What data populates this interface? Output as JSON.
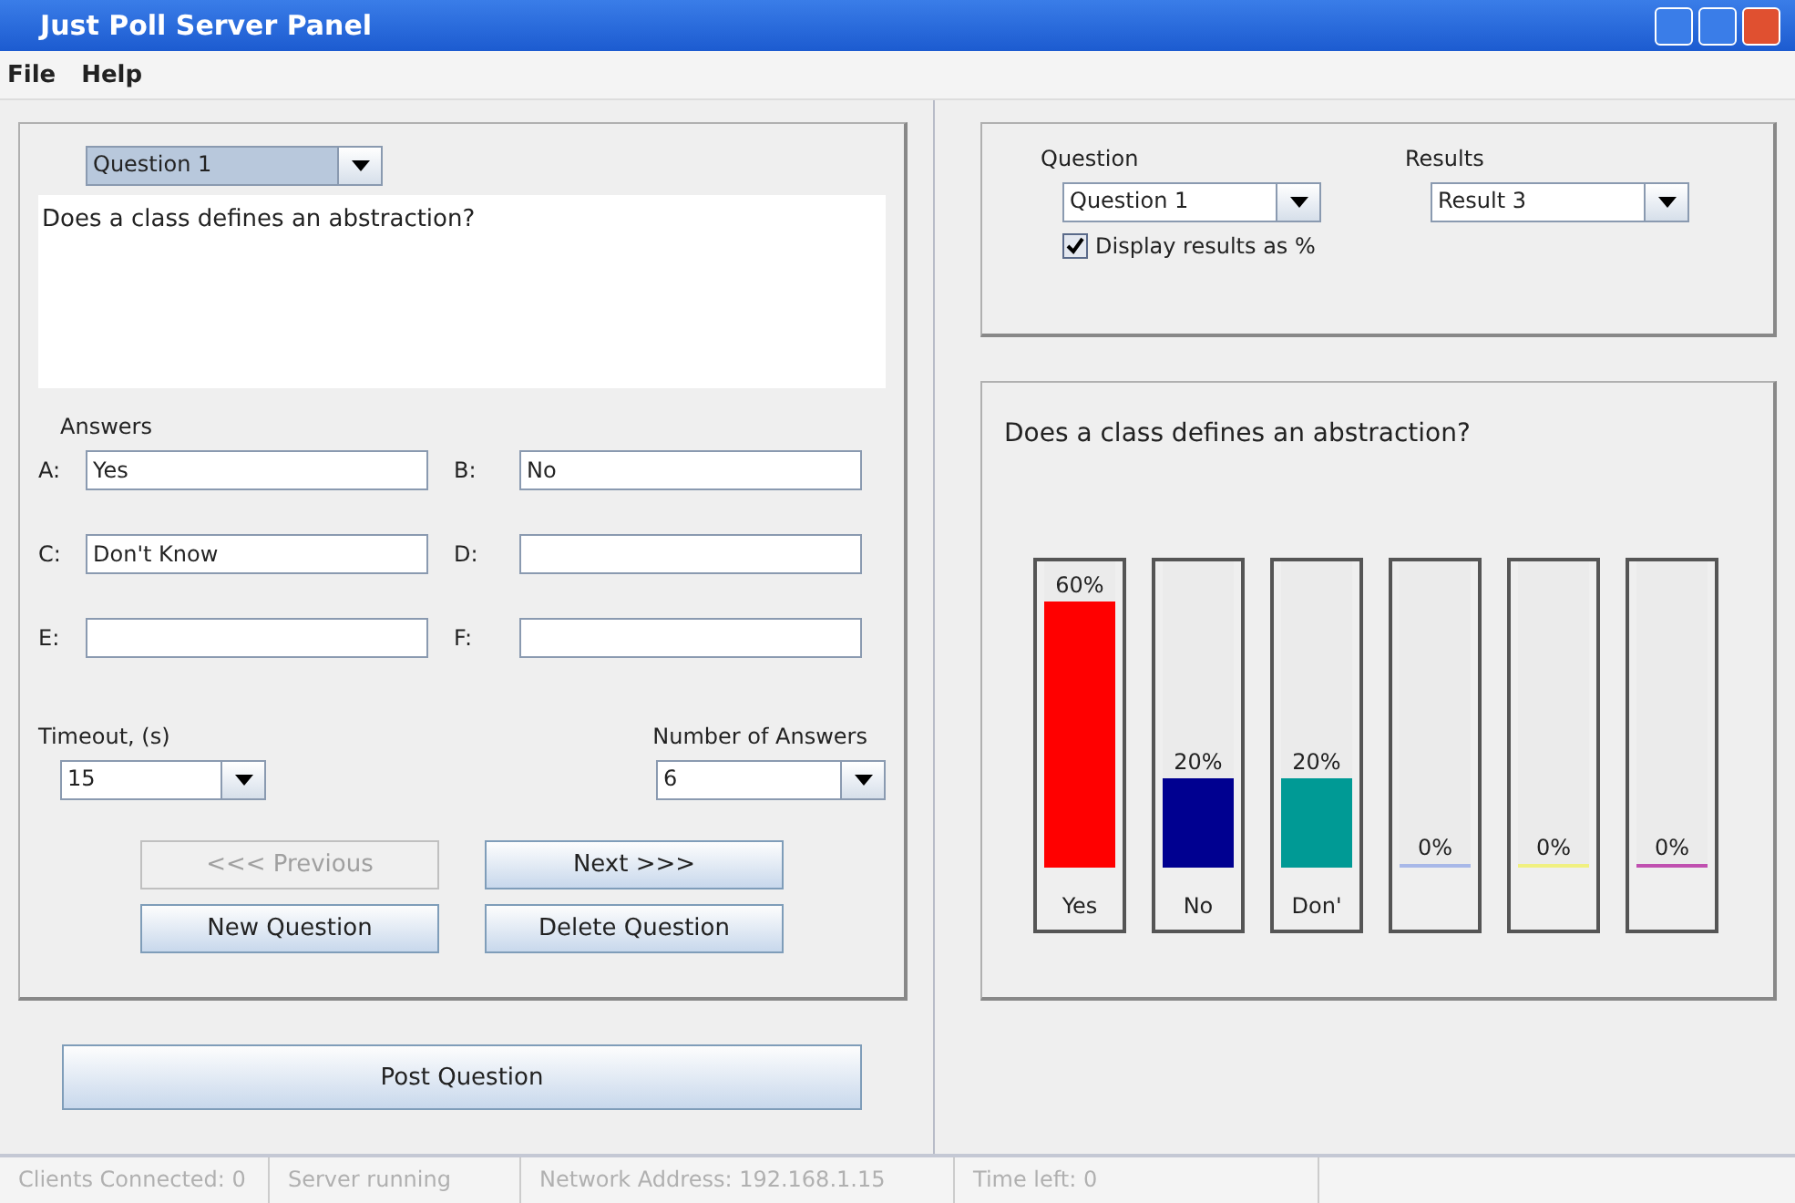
{
  "window": {
    "title": "Just Poll Server Panel"
  },
  "menu": [
    "File",
    "Help"
  ],
  "editor": {
    "question_select": "Question 1",
    "question_text": "Does a class defines an abstraction?",
    "answers_label": "Answers",
    "answers": [
      {
        "letter": "A:",
        "value": "Yes"
      },
      {
        "letter": "B:",
        "value": "No"
      },
      {
        "letter": "C:",
        "value": "Don't Know"
      },
      {
        "letter": "D:"
      },
      {
        "letter": "E:"
      },
      {
        "letter": "F:"
      }
    ],
    "timeout_label": "Timeout, (s)",
    "timeout": "15",
    "count_label": "Number of Answers",
    "count": "6",
    "buttons": [
      {
        "label": "<<< Previous",
        "disabled": true
      },
      {
        "label": "Next >>>",
        "disabled": false
      },
      {
        "label": "New Question",
        "disabled": false
      },
      {
        "label": "Delete Question",
        "disabled": false
      }
    ]
  },
  "post_button": "Post Question",
  "results_controls": {
    "question_label": "Question",
    "question": "Question 1",
    "results_label": "Results",
    "results": "Result 3",
    "percent_label": "Display results as %",
    "percent_checked": true
  },
  "chart": {
    "title": "Does a class defines an abstraction?",
    "bars": [
      {
        "reading": "60%",
        "level": 0.87,
        "color": "#ff0000",
        "label": "Yes"
      },
      {
        "reading": "20%",
        "level": 0.29,
        "color": "#000090",
        "label": "No"
      },
      {
        "reading": "20%",
        "level": 0.29,
        "color": "#009a95",
        "label": "Don'"
      },
      {
        "reading": "0%",
        "level": 0,
        "color": "#a8b8e8"
      },
      {
        "reading": "0%",
        "level": 0,
        "color": "#f0f080"
      },
      {
        "reading": "0%",
        "level": 0,
        "color": "#c050b0"
      }
    ]
  },
  "status_bar": [
    "Clients Connected: 0",
    "Server running",
    "Network Address: 192.168.1.15",
    "Time left: 0"
  ]
}
